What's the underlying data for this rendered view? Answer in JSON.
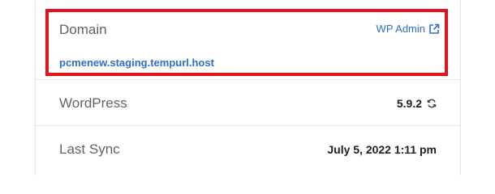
{
  "domain_card": {
    "label": "Domain",
    "wp_admin_link": "WP Admin",
    "external_link_icon": "external-link-icon",
    "url": "pcmenew.staging.tempurl.host",
    "highlight_color": "#e3141e",
    "link_color": "#2c6ecb"
  },
  "wordpress_row": {
    "label": "WordPress",
    "version": "5.9.2",
    "sync_icon": "sync-icon"
  },
  "last_sync_row": {
    "label": "Last Sync",
    "value": "July 5, 2022 1:11 pm"
  }
}
